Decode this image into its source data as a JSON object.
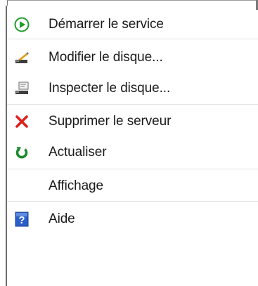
{
  "context_menu": {
    "items": [
      {
        "label": "Démarrer le service",
        "icon": "play-icon"
      },
      {
        "label": "Modifier le disque...",
        "icon": "edit-disk-icon"
      },
      {
        "label": "Inspecter le disque...",
        "icon": "inspect-disk-icon"
      },
      {
        "label": "Supprimer le serveur",
        "icon": "delete-x-icon"
      },
      {
        "label": "Actualiser",
        "icon": "refresh-icon"
      },
      {
        "label": "Affichage",
        "icon": ""
      },
      {
        "label": "Aide",
        "icon": "help-icon"
      }
    ]
  },
  "colors": {
    "play_green": "#1f9b2a",
    "delete_red": "#e0201b",
    "refresh_green": "#1b8a2c",
    "help_blue": "#2a5fc9",
    "separator": "#e3e3e3"
  }
}
